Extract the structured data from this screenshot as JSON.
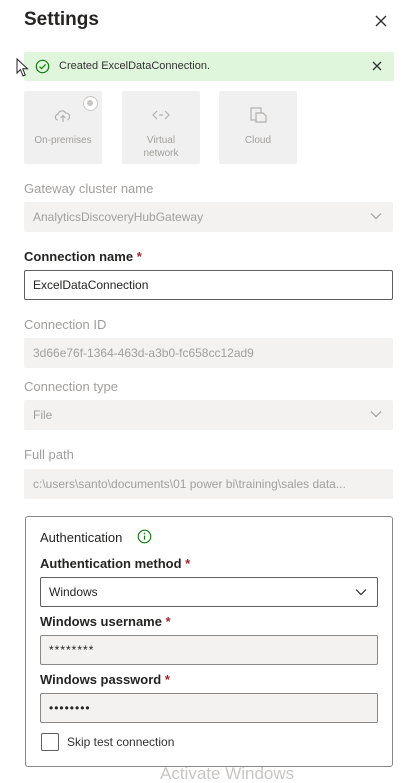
{
  "header": {
    "title": "Settings"
  },
  "toast": {
    "message": "Created ExcelDataConnection."
  },
  "gateway_tiles": [
    {
      "label": "On-premises",
      "icon": "cloud-upload-icon",
      "selected": true
    },
    {
      "label": "Virtual network",
      "icon": "code-arrows-icon"
    },
    {
      "label": "Cloud",
      "icon": "cloud-copy-icon"
    }
  ],
  "gateway_cluster": {
    "label": "Gateway cluster name",
    "value": "AnalyticsDiscoveryHubGateway"
  },
  "connection_name": {
    "label": "Connection name",
    "required_mark": "*",
    "value": "ExcelDataConnection"
  },
  "connection_id": {
    "label": "Connection ID",
    "value": "3d66e76f-1364-463d-a3b0-fc658cc12ad9"
  },
  "connection_type": {
    "label": "Connection type",
    "value": "File"
  },
  "full_path": {
    "label": "Full path",
    "value": "c:\\users\\santo\\documents\\01 power bi\\training\\sales data..."
  },
  "authentication": {
    "title": "Authentication",
    "method_label": "Authentication method",
    "method_value": "Windows",
    "username_label": "Windows username",
    "username_value": "********",
    "password_label": "Windows password",
    "password_value": "••••••••",
    "required_mark": "*",
    "skip_test_label": "Skip test connection"
  },
  "watermark": "Activate Windows",
  "colors": {
    "toast_bg": "#dff6dd",
    "success_green": "#107c10",
    "required_red": "#a4262c"
  }
}
